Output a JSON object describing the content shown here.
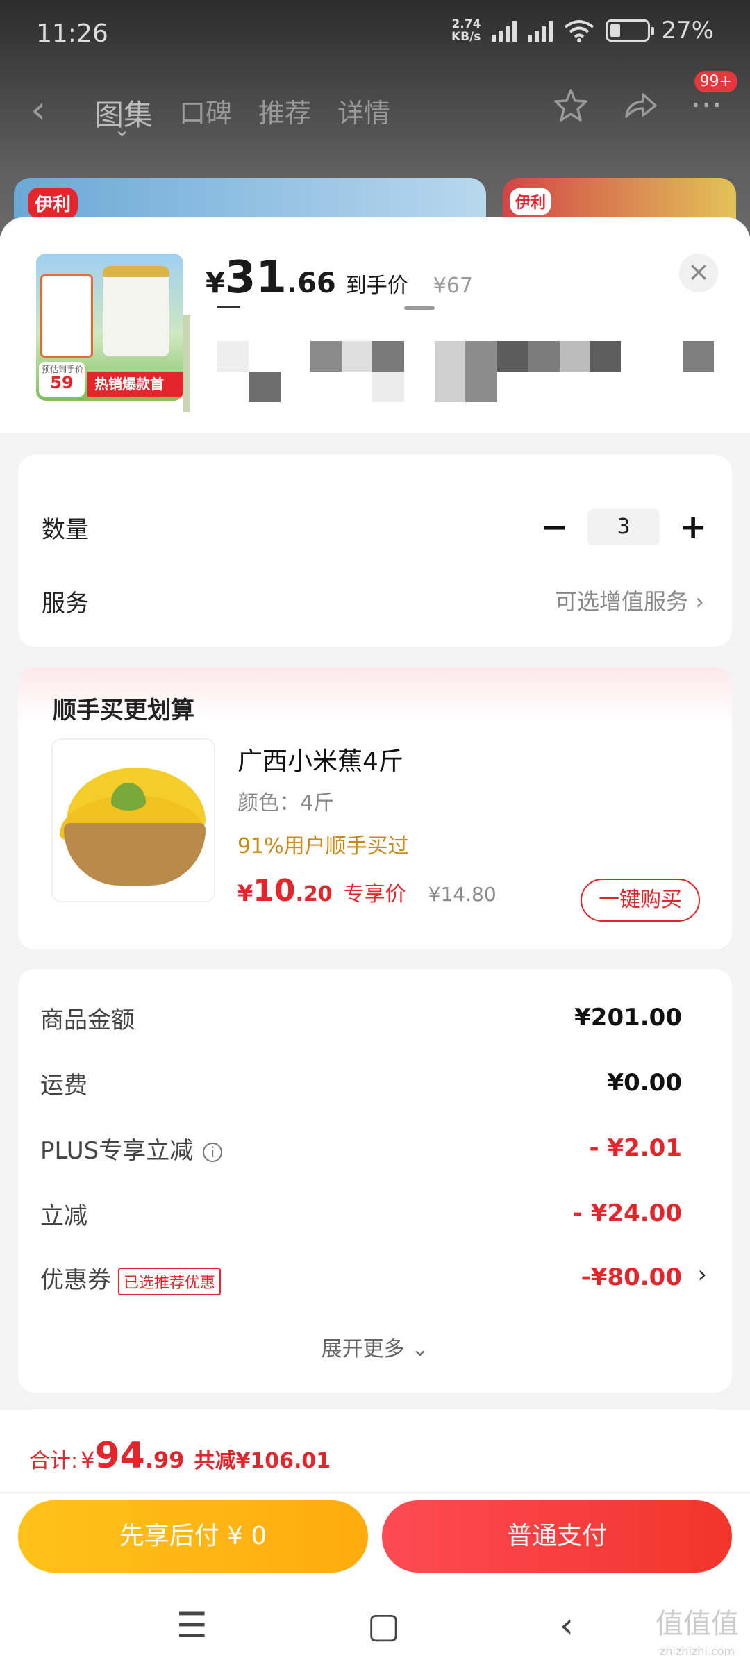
{
  "status_bar": {
    "time": "11:26",
    "net_speed": "2.74",
    "net_unit": "KB/s",
    "battery": "27%"
  },
  "nav": {
    "tabs": [
      "图集",
      "口碑",
      "推荐",
      "详情"
    ],
    "badge": "99+"
  },
  "background": {
    "brand_left": "伊利",
    "brand_right": "伊利"
  },
  "product": {
    "price_symbol": "¥",
    "price_int": "31",
    "price_dec": ".66",
    "price_label": "到手价",
    "orig_price": "¥67",
    "thumb_price_label": "预估到手价",
    "thumb_price": "59",
    "thumb_banner": "热销爆款首"
  },
  "quantity": {
    "label": "数量",
    "value": "3",
    "minus": "−",
    "plus": "+"
  },
  "service": {
    "label": "服务",
    "value": "可选增值服务"
  },
  "addon": {
    "title": "顺手买更划算",
    "name": "广西小米蕉4斤",
    "color": "颜色：4斤",
    "tip": "91%用户顺手买过",
    "price_symbol": "¥",
    "price_int": "10",
    "price_dec": ".20",
    "price_label": "专享价",
    "orig_price": "¥14.80",
    "buy_button": "一键购买"
  },
  "fees": [
    {
      "label": "商品金额",
      "amount": "¥201.00"
    },
    {
      "label": "运费",
      "amount": "¥0.00"
    },
    {
      "label": "PLUS专享立减",
      "amount": "- ¥2.01"
    },
    {
      "label": "立减",
      "amount": "- ¥24.00"
    },
    {
      "label": "优惠券",
      "tag": "已选推荐优惠",
      "amount": "-¥80.00"
    }
  ],
  "expand": "展开更多",
  "footer": {
    "total_label": "合计:",
    "total_symbol": "¥",
    "total_int": "94",
    "total_dec": ".99",
    "saved": "共减¥106.01",
    "pay_later": "先享后付 ¥ 0",
    "pay_normal": "普通支付"
  },
  "watermark": {
    "text": "值值值",
    "url": "zhizhizhi.com"
  },
  "colors": {
    "accent_red": "#e3262b",
    "pay_later": "#ffb714",
    "pay_normal": "#f33f3a"
  }
}
